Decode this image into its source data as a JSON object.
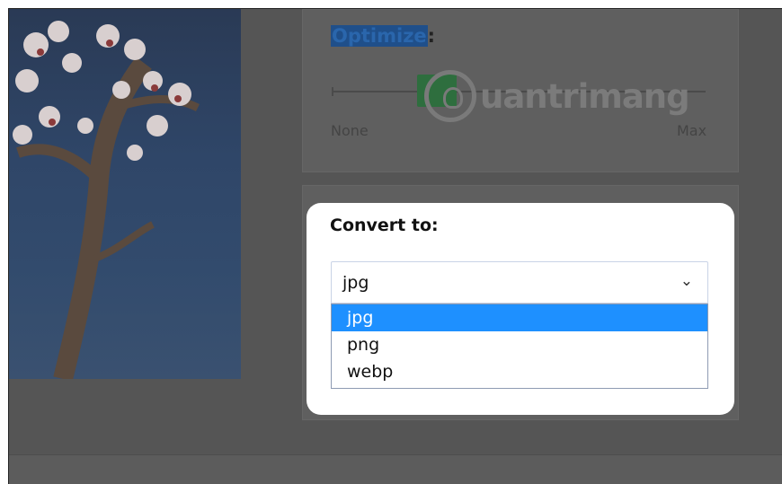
{
  "optimize_panel": {
    "title_highlighted": "Optimize",
    "title_suffix": ":",
    "slider_min_label": "None",
    "slider_max_label": "Max"
  },
  "watermark": {
    "text": "uantrimang"
  },
  "convert_card": {
    "title": "Convert to:",
    "select_value": "jpg",
    "options": [
      {
        "label": "jpg",
        "selected": true
      },
      {
        "label": "png",
        "selected": false
      },
      {
        "label": "webp",
        "selected": false
      }
    ]
  },
  "colors": {
    "overlay": "#555555",
    "selected_option": "#1e90ff",
    "card_bg": "#ffffff"
  },
  "icons": {
    "chevron": "chevron-down-icon",
    "watermark_logo": "lightbulb-icon"
  }
}
